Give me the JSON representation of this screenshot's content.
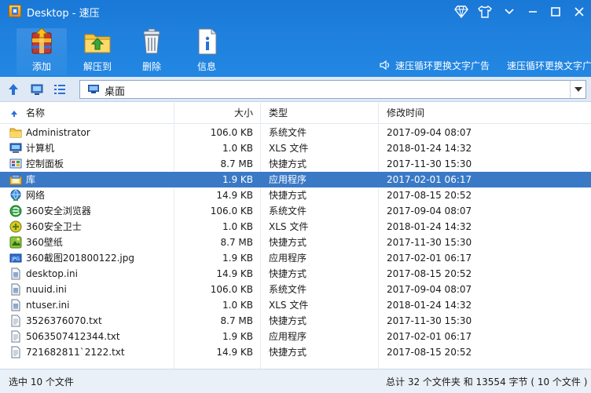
{
  "window": {
    "title": "Desktop - 速压"
  },
  "toolbar": {
    "add_label": "添加",
    "extract_label": "解压到",
    "delete_label": "删除",
    "info_label": "信息"
  },
  "ads": {
    "ad1": "速压循环更换文字广告",
    "ad2": "速压循环更换文字广告"
  },
  "address": {
    "path": "桌面"
  },
  "columns": {
    "name": "名称",
    "size": "大小",
    "type": "类型",
    "modified": "修改时间"
  },
  "files": [
    {
      "name": "Administrator",
      "size": "106.0 KB",
      "type": "系统文件",
      "modified": "2017-09-04 08:07",
      "icon": "folder-icon"
    },
    {
      "name": "计算机",
      "size": "1.0 KB",
      "type": "XLS 文件",
      "modified": "2018-01-24 14:32",
      "icon": "computer-icon"
    },
    {
      "name": "控制面板",
      "size": "8.7 MB",
      "type": "快捷方式",
      "modified": "2017-11-30 15:30",
      "icon": "control-panel-icon"
    },
    {
      "name": "库",
      "size": "1.9 KB",
      "type": "应用程序",
      "modified": "2017-02-01 06:17",
      "icon": "library-icon"
    },
    {
      "name": "网络",
      "size": "14.9 KB",
      "type": "快捷方式",
      "modified": "2017-08-15 20:52",
      "icon": "network-icon"
    },
    {
      "name": "360安全浏览器",
      "size": "106.0 KB",
      "type": "系统文件",
      "modified": "2017-09-04 08:07",
      "icon": "browser-icon"
    },
    {
      "name": "360安全卫士",
      "size": "1.0 KB",
      "type": "XLS 文件",
      "modified": "2018-01-24 14:32",
      "icon": "security-guard-icon"
    },
    {
      "name": "360壁纸",
      "size": "8.7 MB",
      "type": "快捷方式",
      "modified": "2017-11-30 15:30",
      "icon": "wallpaper-icon"
    },
    {
      "name": "360截图201800122.jpg",
      "size": "1.9 KB",
      "type": "应用程序",
      "modified": "2017-02-01 06:17",
      "icon": "jpg-icon"
    },
    {
      "name": "desktop.ini",
      "size": "14.9 KB",
      "type": "快捷方式",
      "modified": "2017-08-15 20:52",
      "icon": "ini-file-icon"
    },
    {
      "name": "nuuid.ini",
      "size": "106.0 KB",
      "type": "系统文件",
      "modified": "2017-09-04 08:07",
      "icon": "ini-file-icon"
    },
    {
      "name": "ntuser.ini",
      "size": "1.0 KB",
      "type": "XLS 文件",
      "modified": "2018-01-24 14:32",
      "icon": "ini-file-icon"
    },
    {
      "name": "3526376070.txt",
      "size": "8.7 MB",
      "type": "快捷方式",
      "modified": "2017-11-30 15:30",
      "icon": "text-file-icon"
    },
    {
      "name": "5063507412344.txt",
      "size": "1.9 KB",
      "type": "应用程序",
      "modified": "2017-02-01 06:17",
      "icon": "text-file-icon"
    },
    {
      "name": "721682811`2122.txt",
      "size": "14.9 KB",
      "type": "快捷方式",
      "modified": "2017-08-15 20:52",
      "icon": "text-file-icon"
    }
  ],
  "selected_index": 3,
  "status": {
    "left": "选中 10 个文件",
    "right": "总计 32 个文件夹 和 13554 字节 ( 10 个文件 )"
  },
  "colors": {
    "accent": "#1f80de",
    "selection": "#3a79c6"
  }
}
